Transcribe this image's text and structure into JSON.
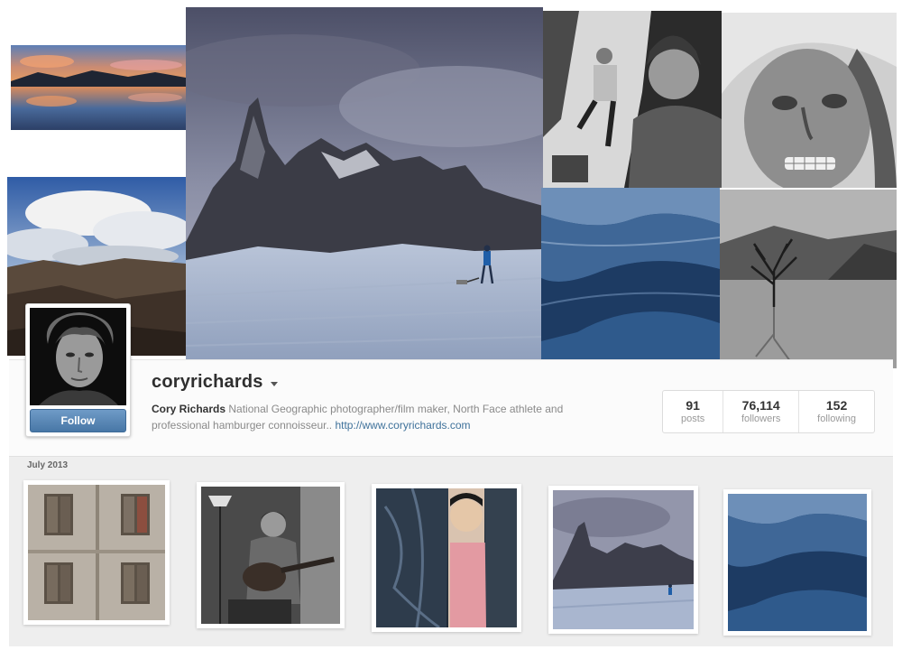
{
  "profile": {
    "username": "coryrichards",
    "full_name": "Cory Richards",
    "bio_line1": "National Geographic photographer/film maker, North Face athlete and",
    "bio_line2": "professional hamburger connoisseur..",
    "website": "http://www.coryrichards.com",
    "follow_label": "Follow"
  },
  "stats": [
    {
      "value": "91",
      "label": "posts"
    },
    {
      "value": "76,114",
      "label": "followers"
    },
    {
      "value": "152",
      "label": "following"
    }
  ],
  "recent": {
    "month_label": "July 2013"
  },
  "colors": {
    "follow_button": "#4f7fb0",
    "link": "#3f729b",
    "username": "#2f2f2f"
  },
  "icons": [
    "caret-down-icon"
  ]
}
